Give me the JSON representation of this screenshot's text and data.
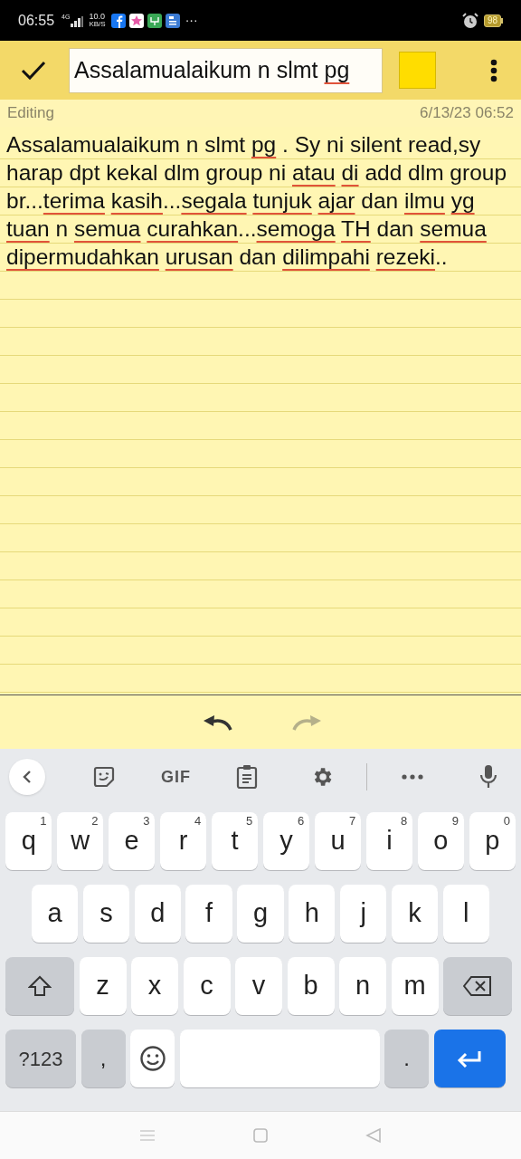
{
  "status_bar": {
    "time": "06:55",
    "network": "4G",
    "speed": "10.0",
    "speed_unit": "KB/S",
    "more": "···",
    "battery": "98"
  },
  "toolbar": {
    "title_segments": [
      {
        "text": "Assalamualaikum n slmt",
        "misspelled": false
      },
      {
        "text": " pg",
        "misspelled": true
      }
    ],
    "color": "#ffdd00"
  },
  "info": {
    "mode": "Editing",
    "timestamp": "6/13/23 06:52"
  },
  "note": {
    "segments": [
      {
        "text": "Assalamualaikum n slmt",
        "misspelled": false
      },
      {
        "text": " pg",
        "misspelled": true
      },
      {
        "text": " . Sy ni silent read,sy harap dpt kekal dlm group ni",
        "misspelled": false
      },
      {
        "text": " atau",
        "misspelled": true
      },
      {
        "text": " di",
        "misspelled": true
      },
      {
        "text": " add dlm group br...",
        "misspelled": false
      },
      {
        "text": "terima",
        "misspelled": true
      },
      {
        "text": " kasih",
        "misspelled": true
      },
      {
        "text": "...",
        "misspelled": false
      },
      {
        "text": "segala",
        "misspelled": true
      },
      {
        "text": " tunjuk",
        "misspelled": true
      },
      {
        "text": " ajar",
        "misspelled": true
      },
      {
        "text": " dan",
        "misspelled": false
      },
      {
        "text": " ilmu",
        "misspelled": true
      },
      {
        "text": " yg",
        "misspelled": true
      },
      {
        "text": " tuan",
        "misspelled": true
      },
      {
        "text": " n",
        "misspelled": false
      },
      {
        "text": " semua",
        "misspelled": true
      },
      {
        "text": " curahkan",
        "misspelled": true
      },
      {
        "text": "...",
        "misspelled": false
      },
      {
        "text": "semoga",
        "misspelled": true
      },
      {
        "text": " TH",
        "misspelled": true
      },
      {
        "text": " dan",
        "misspelled": false
      },
      {
        "text": " semua",
        "misspelled": true
      },
      {
        "text": " dipermudahkan",
        "misspelled": true
      },
      {
        "text": " urusan",
        "misspelled": true
      },
      {
        "text": " dan",
        "misspelled": false
      },
      {
        "text": " dilimpahi",
        "misspelled": true
      },
      {
        "text": " rezeki",
        "misspelled": true
      },
      {
        "text": "..",
        "misspelled": false
      }
    ]
  },
  "edit_bar": {
    "undo_enabled": true,
    "redo_enabled": false
  },
  "keyboard": {
    "suggestion_bar": {
      "gif": "GIF"
    },
    "rows": [
      {
        "keys": [
          {
            "kind": "letter",
            "label": "q",
            "hint": "1"
          },
          {
            "kind": "letter",
            "label": "w",
            "hint": "2"
          },
          {
            "kind": "letter",
            "label": "e",
            "hint": "3"
          },
          {
            "kind": "letter",
            "label": "r",
            "hint": "4"
          },
          {
            "kind": "letter",
            "label": "t",
            "hint": "5"
          },
          {
            "kind": "letter",
            "label": "y",
            "hint": "6"
          },
          {
            "kind": "letter",
            "label": "u",
            "hint": "7"
          },
          {
            "kind": "letter",
            "label": "i",
            "hint": "8"
          },
          {
            "kind": "letter",
            "label": "o",
            "hint": "9"
          },
          {
            "kind": "letter",
            "label": "p",
            "hint": "0"
          }
        ]
      },
      {
        "keys": [
          {
            "kind": "letter",
            "label": "a"
          },
          {
            "kind": "letter",
            "label": "s"
          },
          {
            "kind": "letter",
            "label": "d"
          },
          {
            "kind": "letter",
            "label": "f"
          },
          {
            "kind": "letter",
            "label": "g"
          },
          {
            "kind": "letter",
            "label": "h"
          },
          {
            "kind": "letter",
            "label": "j"
          },
          {
            "kind": "letter",
            "label": "k"
          },
          {
            "kind": "letter",
            "label": "l"
          }
        ]
      },
      {
        "keys": [
          {
            "kind": "shift"
          },
          {
            "kind": "letter",
            "label": "z"
          },
          {
            "kind": "letter",
            "label": "x"
          },
          {
            "kind": "letter",
            "label": "c"
          },
          {
            "kind": "letter",
            "label": "v"
          },
          {
            "kind": "letter",
            "label": "b"
          },
          {
            "kind": "letter",
            "label": "n"
          },
          {
            "kind": "letter",
            "label": "m"
          },
          {
            "kind": "backspace"
          }
        ]
      },
      {
        "keys": [
          {
            "kind": "symbols",
            "label": "?123"
          },
          {
            "kind": "punct",
            "label": ","
          },
          {
            "kind": "emoji"
          },
          {
            "kind": "space"
          },
          {
            "kind": "punct",
            "label": "."
          },
          {
            "kind": "enter"
          }
        ]
      }
    ]
  }
}
